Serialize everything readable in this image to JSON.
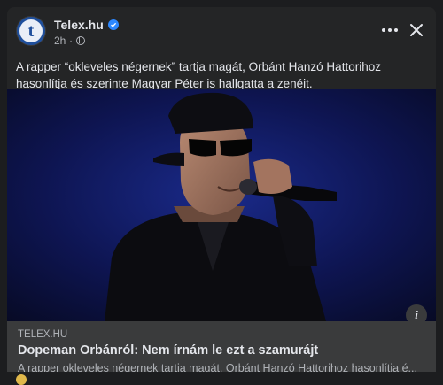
{
  "post": {
    "page_name": "Telex.hu",
    "avatar_letter": "t",
    "time": "2h",
    "dot": "·",
    "text": "A rapper “okleveles négernek” tartja magát, Orbánt Hanzó Hattorihoz hasonlítja és szerinte Magyar Péter is hallgatta a zenéit.",
    "icons": [
      "verified-badge-icon",
      "globe-icon",
      "more-icon",
      "close-icon",
      "info-icon"
    ]
  },
  "link_preview": {
    "domain": "TELEX.HU",
    "title": "Dopeman Orbánról: Nem írnám le ezt a szamurájt",
    "description": "A rapper okleveles négernek tartja magát, Orbánt Hanzó Hattorihoz hasonlítja é..."
  },
  "info_label": "i",
  "colors": {
    "background": "#1c1d1f",
    "card": "#242526",
    "preview": "#3a3b3c",
    "accent": "#2d88ff",
    "text": "#e4e6eb",
    "secondary_text": "#b0b3b8"
  }
}
